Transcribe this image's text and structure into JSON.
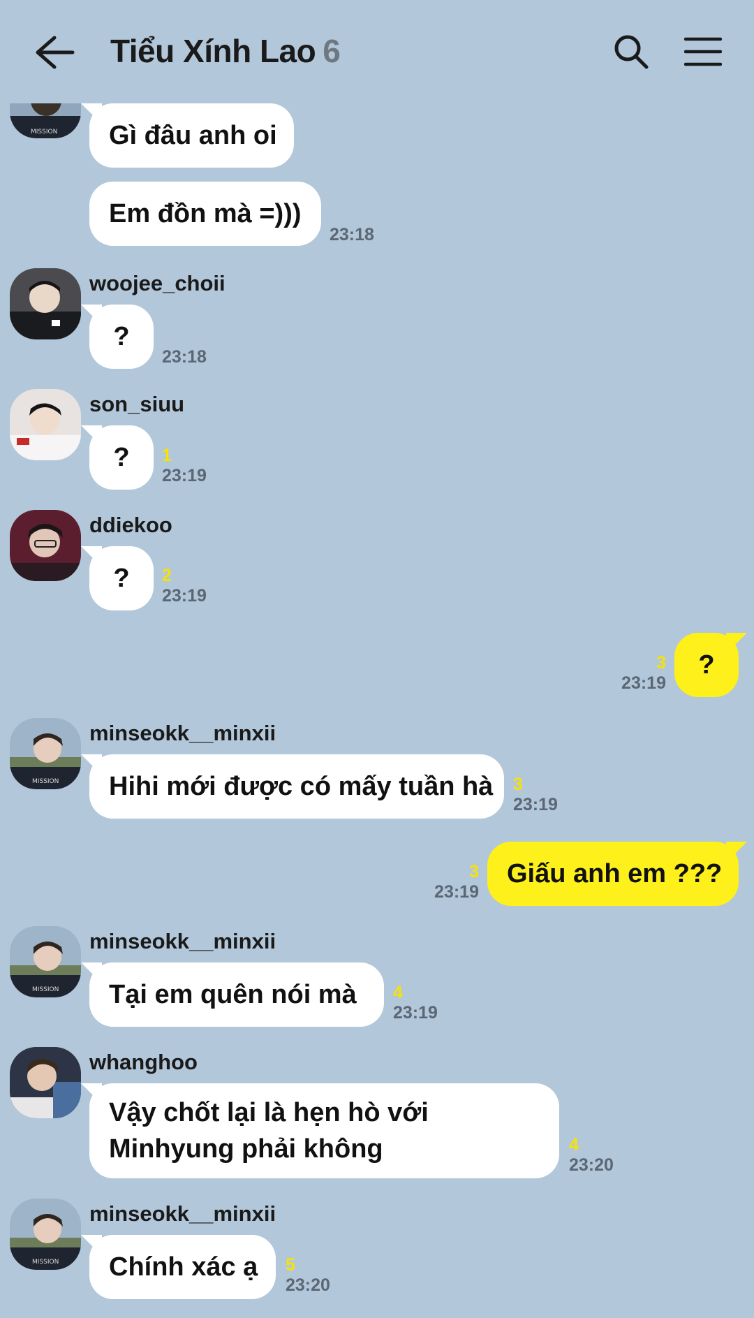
{
  "header": {
    "title": "Tiểu Xính Lao",
    "member_count": "6"
  },
  "messages": [
    {
      "text": "Gì đâu anh oi"
    },
    {
      "text": "Em đồn mà =)))",
      "time": "23:18"
    },
    {
      "sender": "woojee_choii",
      "text": "?",
      "time": "23:18"
    },
    {
      "sender": "son_siuu",
      "text": "?",
      "unread": "1",
      "time": "23:19"
    },
    {
      "sender": "ddiekoo",
      "text": "?",
      "unread": "2",
      "time": "23:19"
    },
    {
      "text": "?",
      "unread": "3",
      "time": "23:19"
    },
    {
      "sender": "minseokk__minxii",
      "text": "Hihi mới được có mấy tuần hà",
      "unread": "3",
      "time": "23:19"
    },
    {
      "text": "Giấu anh em ???",
      "unread": "3",
      "time": "23:19"
    },
    {
      "sender": "minseokk__minxii",
      "text": "Tại em quên nói mà",
      "unread": "4",
      "time": "23:19"
    },
    {
      "sender": "whanghoo",
      "text_line1": "Vậy chốt lại là hẹn hò với",
      "text_line2": "Minhyung phải không",
      "unread": "4",
      "time": "23:20"
    },
    {
      "sender": "minseokk__minxii",
      "text": "Chính xác ạ",
      "unread": "5",
      "time": "23:20"
    }
  ],
  "colors": {
    "background": "#b2c7da",
    "my_bubble": "#fef01b",
    "other_bubble": "#ffffff",
    "unread_count": "#f6e20a"
  }
}
